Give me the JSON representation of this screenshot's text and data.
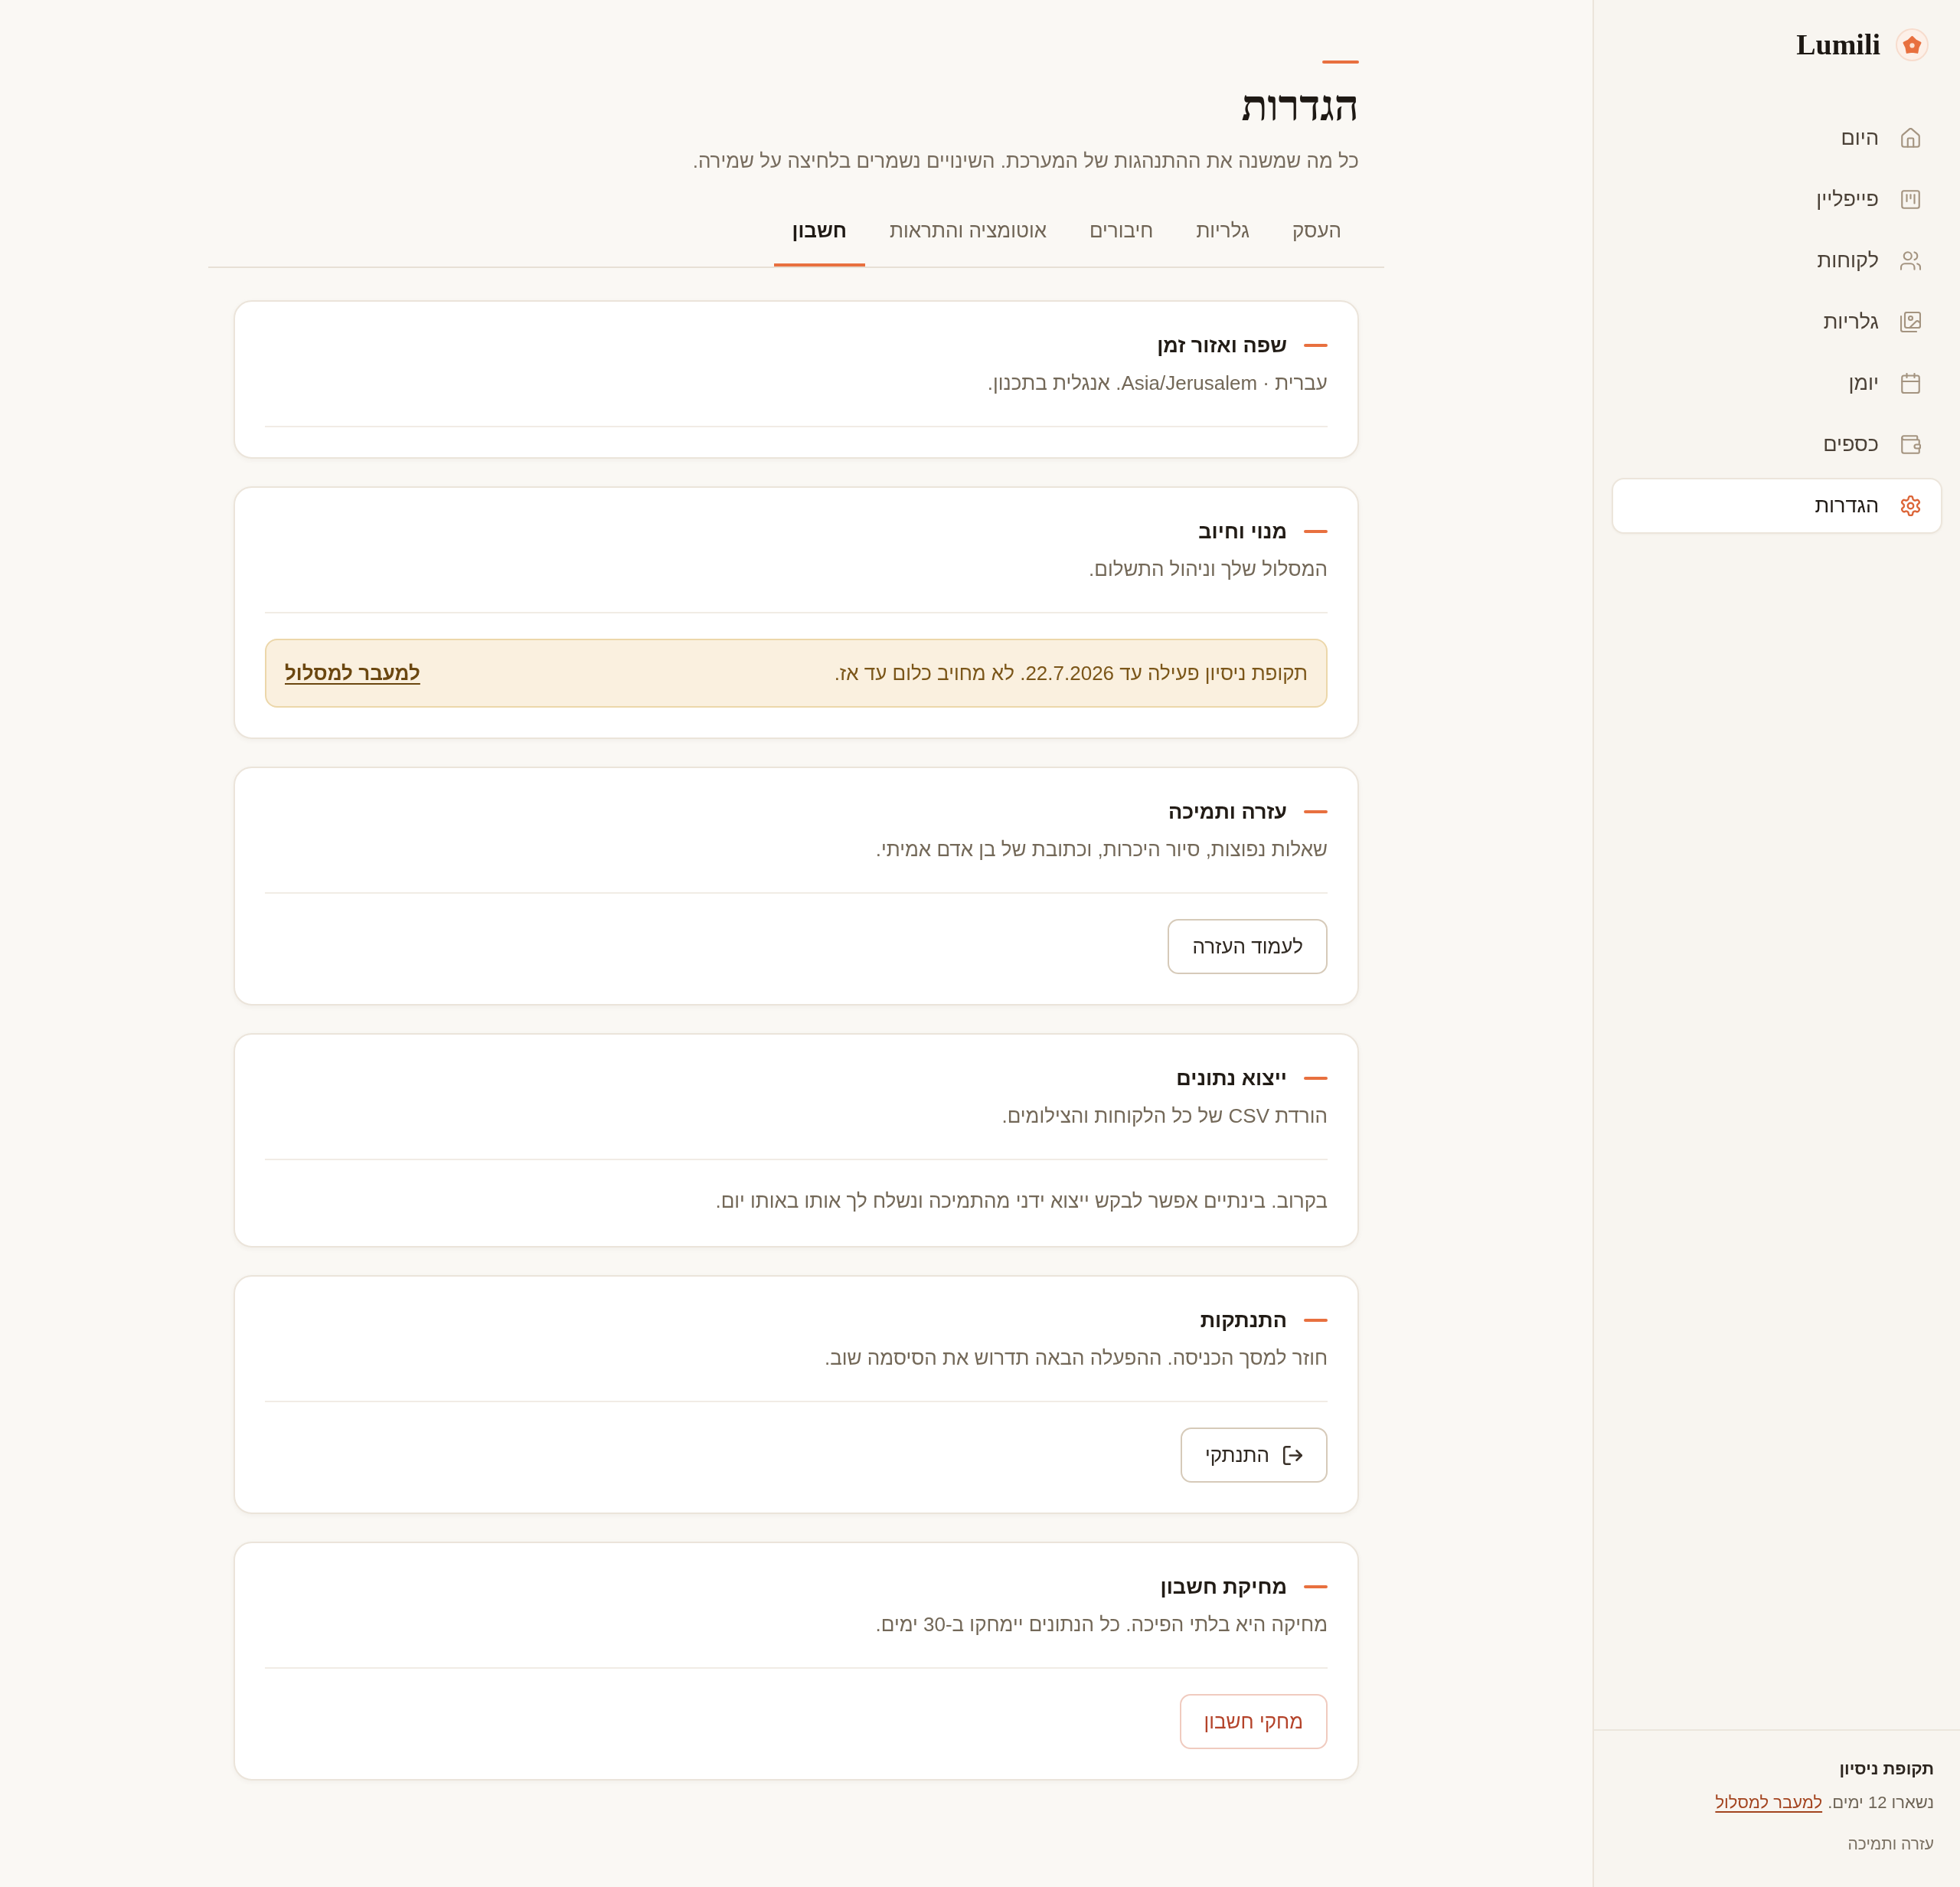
{
  "sidebar": {
    "brand": "Lumili",
    "nav": [
      {
        "label": "היום",
        "selected": false
      },
      {
        "label": "פייפליין",
        "selected": false
      },
      {
        "label": "לקוחות",
        "selected": false
      },
      {
        "label": "גלריות",
        "selected": false
      },
      {
        "label": "יומן",
        "selected": false
      },
      {
        "label": "כספים",
        "selected": false
      },
      {
        "label": "הגדרות",
        "selected": true
      }
    ],
    "trial": {
      "title": "תקופת ניסיון",
      "text": "נשארו 12 ימים.",
      "link": "למעבר למסלול"
    },
    "help_link": "עזרה ותמיכה"
  },
  "header": {
    "title": "הגדרות",
    "subtitle": "כל מה שמשנה את ההתנהגות של המערכת. השינויים נשמרים בלחיצה על שמירה."
  },
  "tabs": [
    {
      "label": "העסק",
      "selected": false
    },
    {
      "label": "גלריות",
      "selected": false
    },
    {
      "label": "חיבורים",
      "selected": false
    },
    {
      "label": "אוטומציה והתראות",
      "selected": false
    },
    {
      "label": "חשבון",
      "selected": true
    }
  ],
  "sections": [
    {
      "kind": "plain",
      "title": "שפה ואזור זמן",
      "description": "עברית · Asia/Jerusalem. אנגלית בתכנון."
    },
    {
      "kind": "notice",
      "title": "מנוי וחיוב",
      "description": "המסלול שלך וניהול התשלום.",
      "notice": {
        "text": "תקופת ניסיון פעילה עד 22.7.2026. לא מחויב כלום עד אז.",
        "link": "למעבר למסלול"
      }
    },
    {
      "kind": "action",
      "title": "עזרה ותמיכה",
      "description": "שאלות נפוצות, סיור היכרות, וכתובת של בן אדם אמיתי.",
      "button": {
        "kind": "outline",
        "label": "לעמוד העזרה"
      }
    },
    {
      "kind": "note",
      "title": "ייצוא נתונים",
      "description": "הורדת CSV של כל הלקוחות והצילומים.",
      "note": "בקרוב. בינתיים אפשר לבקש ייצוא ידני מהתמיכה ונשלח לך אותו באותו יום."
    },
    {
      "kind": "action",
      "title": "התנתקות",
      "description": "חוזר למסך הכניסה. ההפעלה הבאה תדרוש את הסיסמה שוב.",
      "button": {
        "kind": "logout",
        "label": "התנתקי"
      }
    },
    {
      "kind": "action",
      "title": "מחיקת חשבון",
      "description": "מחיקה היא בלתי הפיכה. כל הנתונים יימחקו ב-30 ימים.",
      "button": {
        "kind": "danger",
        "label": "מחקי חשבון"
      }
    }
  ]
}
